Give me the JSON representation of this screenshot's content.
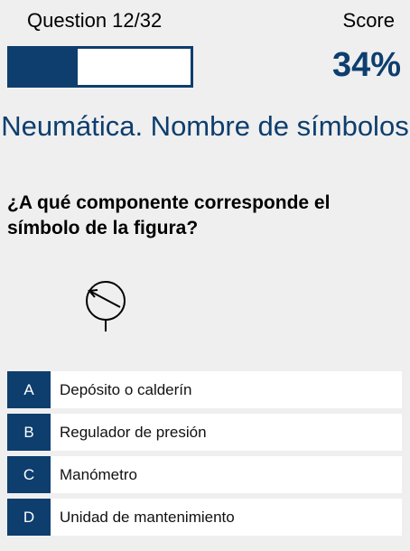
{
  "header": {
    "question_counter": "Question 12/32",
    "score_label": "Score",
    "score_value": "34%",
    "progress_fraction": 0.375
  },
  "quiz": {
    "title": "Neumática. Nombre de símbolos",
    "question": "¿A qué componente corresponde el símbolo de la figura?",
    "figure_icon": "pressure-gauge-symbol-icon"
  },
  "options": [
    {
      "letter": "A",
      "text": "Depósito o calderín"
    },
    {
      "letter": "B",
      "text": "Regulador de presión"
    },
    {
      "letter": "C",
      "text": "Manómetro"
    },
    {
      "letter": "D",
      "text": "Unidad de mantenimiento"
    }
  ],
  "colors": {
    "accent": "#0d3e6e",
    "background": "#efefef",
    "option_background": "#ffffff"
  }
}
